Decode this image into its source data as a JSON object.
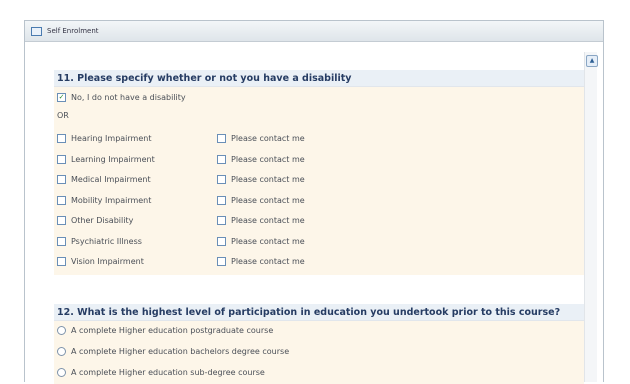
{
  "window": {
    "title": "Self Enrolment"
  },
  "scroll": {
    "up_glyph": "▲"
  },
  "q11": {
    "heading": "11. Please specify whether or not you have a disability",
    "no_disability_label": "No, I do not have a disability",
    "no_disability_checked": true,
    "check_glyph": "✓",
    "or_label": "OR",
    "impairments": [
      {
        "label": "Hearing Impairment",
        "contact": "Please contact me"
      },
      {
        "label": "Learning Impairment",
        "contact": "Please contact me"
      },
      {
        "label": "Medical Impairment",
        "contact": "Please contact me"
      },
      {
        "label": "Mobility Impairment",
        "contact": "Please contact me"
      },
      {
        "label": "Other Disability",
        "contact": "Please contact me"
      },
      {
        "label": "Psychiatric Illness",
        "contact": "Please contact me"
      },
      {
        "label": "Vision Impairment",
        "contact": "Please contact me"
      }
    ]
  },
  "q12": {
    "heading": "12. What is the highest level of participation in education you undertook prior to this course?",
    "options": [
      "A complete Higher education postgraduate course",
      "A complete Higher education bachelors degree course",
      "A complete Higher education sub-degree course"
    ]
  }
}
